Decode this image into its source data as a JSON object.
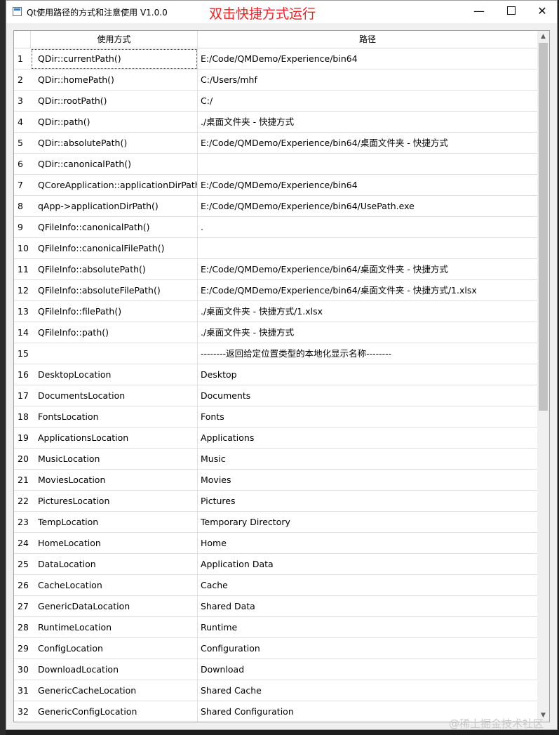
{
  "window": {
    "title": "Qt使用路径的方式和注意使用 V1.0.0",
    "caption": "双击快捷方式运行",
    "minimize_glyph": "—",
    "close_glyph": "✕"
  },
  "table": {
    "headers": [
      "使用方式",
      "路径"
    ],
    "rows": [
      {
        "num": "1",
        "method": "QDir::currentPath()",
        "path": "E:/Code/QMDemo/Experience/bin64"
      },
      {
        "num": "2",
        "method": "QDir::homePath()",
        "path": "C:/Users/mhf"
      },
      {
        "num": "3",
        "method": "QDir::rootPath()",
        "path": "C:/"
      },
      {
        "num": "4",
        "method": "QDir::path()",
        "path": "./桌面文件夹 - 快捷方式"
      },
      {
        "num": "5",
        "method": "QDir::absolutePath()",
        "path": "E:/Code/QMDemo/Experience/bin64/桌面文件夹 - 快捷方式"
      },
      {
        "num": "6",
        "method": "QDir::canonicalPath()",
        "path": ""
      },
      {
        "num": "7",
        "method": "QCoreApplication::applicationDirPath()",
        "path": "E:/Code/QMDemo/Experience/bin64"
      },
      {
        "num": "8",
        "method": "qApp->applicationDirPath()",
        "path": "E:/Code/QMDemo/Experience/bin64/UsePath.exe"
      },
      {
        "num": "9",
        "method": "QFileInfo::canonicalPath()",
        "path": "."
      },
      {
        "num": "10",
        "method": "QFileInfo::canonicalFilePath()",
        "path": ""
      },
      {
        "num": "11",
        "method": "QFileInfo::absolutePath()",
        "path": "E:/Code/QMDemo/Experience/bin64/桌面文件夹 - 快捷方式"
      },
      {
        "num": "12",
        "method": "QFileInfo::absoluteFilePath()",
        "path": "E:/Code/QMDemo/Experience/bin64/桌面文件夹 - 快捷方式/1.xlsx"
      },
      {
        "num": "13",
        "method": "QFileInfo::filePath()",
        "path": "./桌面文件夹 - 快捷方式/1.xlsx"
      },
      {
        "num": "14",
        "method": "QFileInfo::path()",
        "path": "./桌面文件夹 - 快捷方式"
      },
      {
        "num": "15",
        "method": "",
        "path": "--------返回给定位置类型的本地化显示名称--------"
      },
      {
        "num": "16",
        "method": "DesktopLocation",
        "path": "Desktop"
      },
      {
        "num": "17",
        "method": "DocumentsLocation",
        "path": "Documents"
      },
      {
        "num": "18",
        "method": "FontsLocation",
        "path": "Fonts"
      },
      {
        "num": "19",
        "method": "ApplicationsLocation",
        "path": "Applications"
      },
      {
        "num": "20",
        "method": "MusicLocation",
        "path": "Music"
      },
      {
        "num": "21",
        "method": "MoviesLocation",
        "path": "Movies"
      },
      {
        "num": "22",
        "method": "PicturesLocation",
        "path": "Pictures"
      },
      {
        "num": "23",
        "method": "TempLocation",
        "path": "Temporary Directory"
      },
      {
        "num": "24",
        "method": "HomeLocation",
        "path": "Home"
      },
      {
        "num": "25",
        "method": "DataLocation",
        "path": "Application Data"
      },
      {
        "num": "26",
        "method": "CacheLocation",
        "path": "Cache"
      },
      {
        "num": "27",
        "method": "GenericDataLocation",
        "path": "Shared Data"
      },
      {
        "num": "28",
        "method": "RuntimeLocation",
        "path": "Runtime"
      },
      {
        "num": "29",
        "method": "ConfigLocation",
        "path": "Configuration"
      },
      {
        "num": "30",
        "method": "DownloadLocation",
        "path": "Download"
      },
      {
        "num": "31",
        "method": "GenericCacheLocation",
        "path": "Shared Cache"
      },
      {
        "num": "32",
        "method": "GenericConfigLocation",
        "path": "Shared Configuration"
      }
    ]
  },
  "watermark": "@稀土掘金技术社区"
}
